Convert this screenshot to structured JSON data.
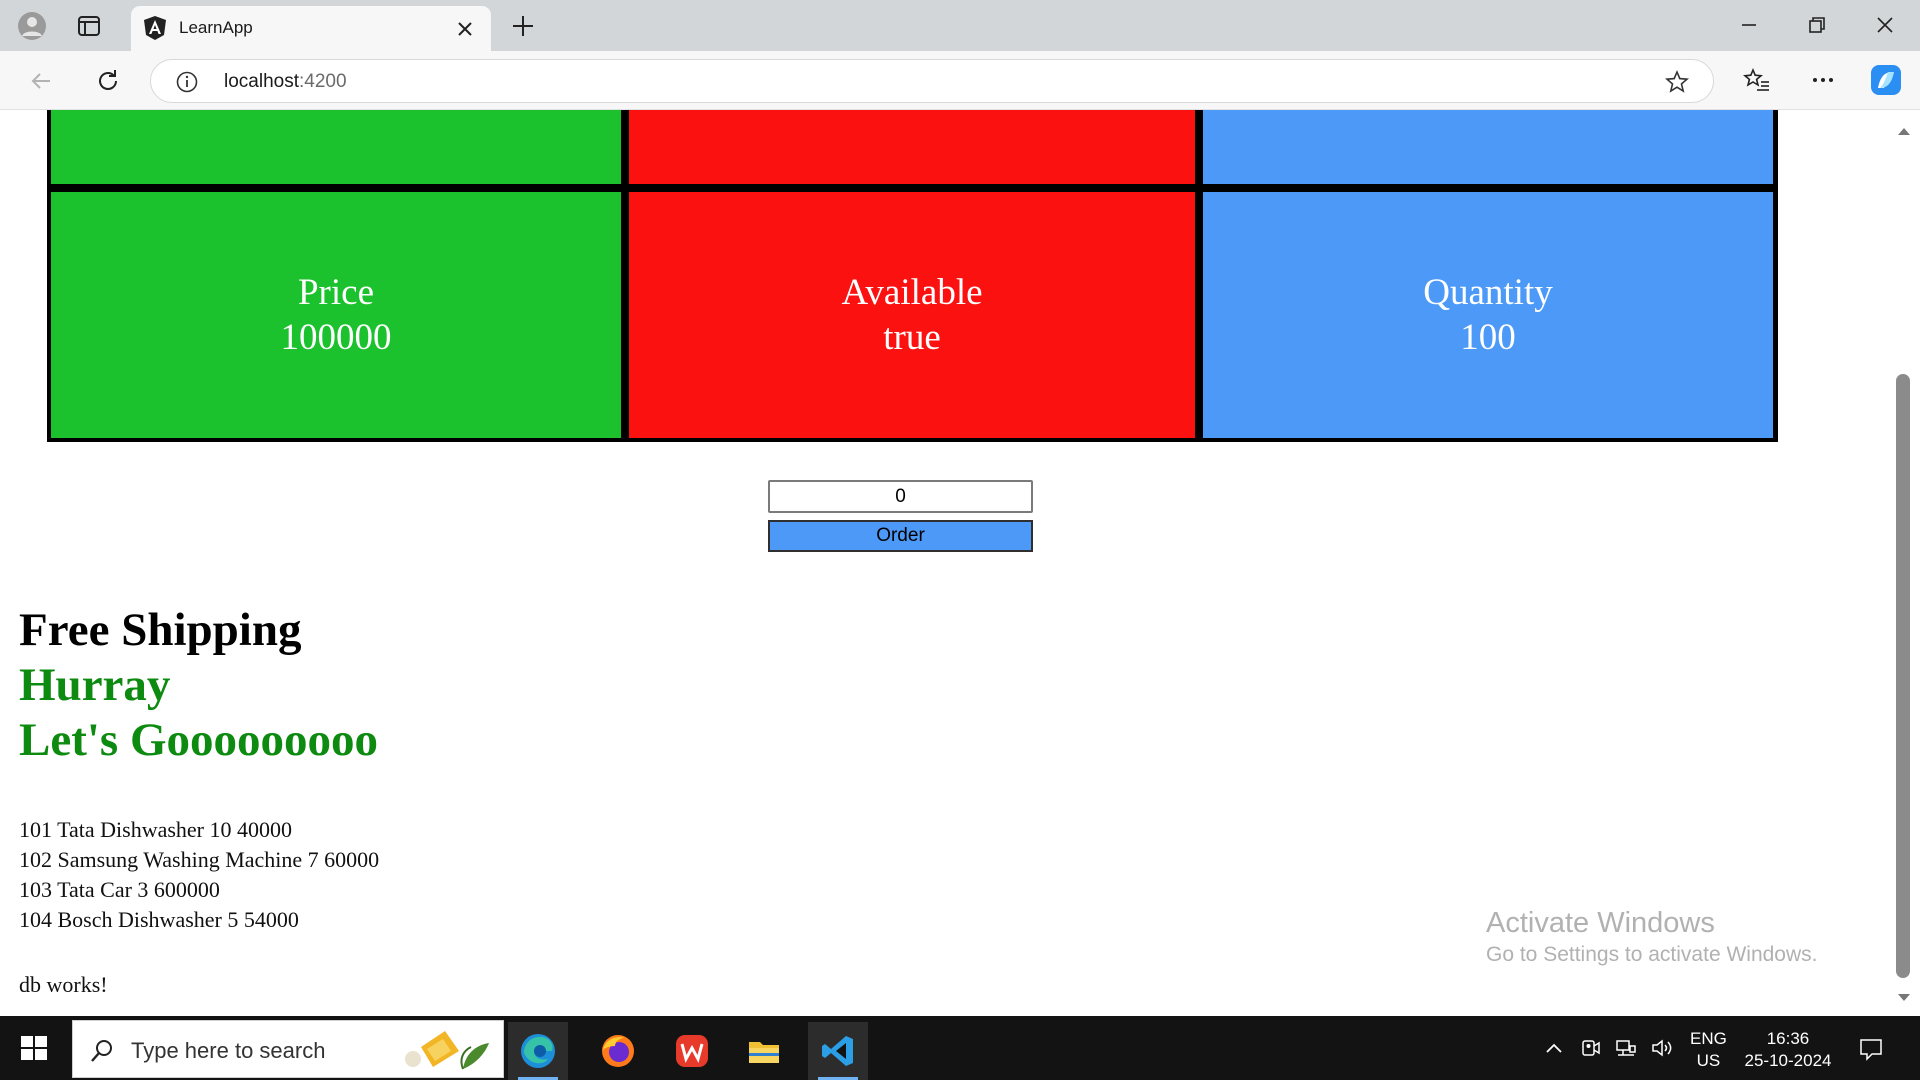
{
  "browser": {
    "tab_title": "LearnApp",
    "address_host": "localhost",
    "address_port": ":4200"
  },
  "grid": {
    "top_row": [
      {
        "label": "",
        "value": "",
        "color": "#1bc22d"
      },
      {
        "label": "",
        "value": "",
        "color": "#fc1111"
      },
      {
        "label": "",
        "value": "",
        "color": "#4c99f7"
      }
    ],
    "bottom_row": [
      {
        "label": "Price",
        "value": "100000",
        "color": "#1bc22d"
      },
      {
        "label": "Available",
        "value": "true",
        "color": "#fc1111"
      },
      {
        "label": "Quantity",
        "value": "100",
        "color": "#4c99f7"
      }
    ]
  },
  "order": {
    "quantity_value": "0",
    "button_label": "Order"
  },
  "headings": {
    "shipping": "Free Shipping",
    "hurray": "Hurray",
    "lets_go": "Let's Gooooooooo"
  },
  "products": [
    "101 Tata Dishwasher 10 40000",
    "102 Samsung Washing Machine 7 60000",
    "103 Tata Car 3 600000",
    "104 Bosch Dishwasher 5 54000"
  ],
  "db_status": "db works!",
  "watermark": {
    "title": "Activate Windows",
    "subtitle": "Go to Settings to activate Windows."
  },
  "taskbar": {
    "search_placeholder": "Type here to search",
    "lang_top": "ENG",
    "lang_bottom": "US",
    "time": "16:36",
    "date": "25-10-2024"
  },
  "colors": {
    "green": "#1bc22d",
    "red": "#fc1111",
    "blue": "#4c99f7",
    "heading_green": "#0d8a10"
  }
}
